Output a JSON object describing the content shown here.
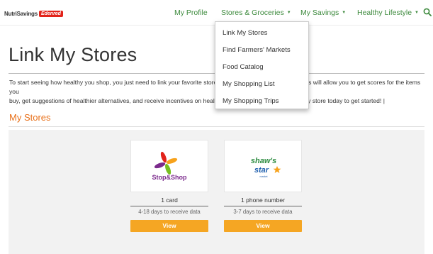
{
  "header": {
    "logo_text": "NutriSavings",
    "logo_badge": "Edenred",
    "nav": {
      "profile": "My Profile",
      "stores": "Stores & Groceries",
      "savings": "My Savings",
      "healthy": "Healthy Lifestyle"
    },
    "caret": "▼"
  },
  "dropdown": {
    "items": [
      "Link My Stores",
      "Find Farmers' Markets",
      "Food Catalog",
      "My Shopping List",
      "My Shopping Trips"
    ]
  },
  "page": {
    "title": "Link My Stores",
    "intro_line1": "To start seeing how healthy you shop, you just need to link your favorite stores by selecting the store below. This will allow you to get scores for the items you",
    "intro_line2": "buy, get suggestions of healthier alternatives, and receive incentives on healthy items. Link your favorite grocery store today to get started! |",
    "section_title": "My Stores"
  },
  "stores": [
    {
      "logo_name": "Stop&Shop",
      "detail": "1 card",
      "sub": "4-18 days to receive data",
      "button": "View"
    },
    {
      "logo_name_top": "shaw's",
      "logo_name_bottom": "star",
      "logo_name_small": "market",
      "detail": "1 phone number",
      "sub": "3-7 days to receive data",
      "button": "View"
    }
  ],
  "colors": {
    "nav_green": "#3d8a3d",
    "section_orange": "#e8701a",
    "button_orange": "#f5a623",
    "brand_red": "#e2231a"
  }
}
